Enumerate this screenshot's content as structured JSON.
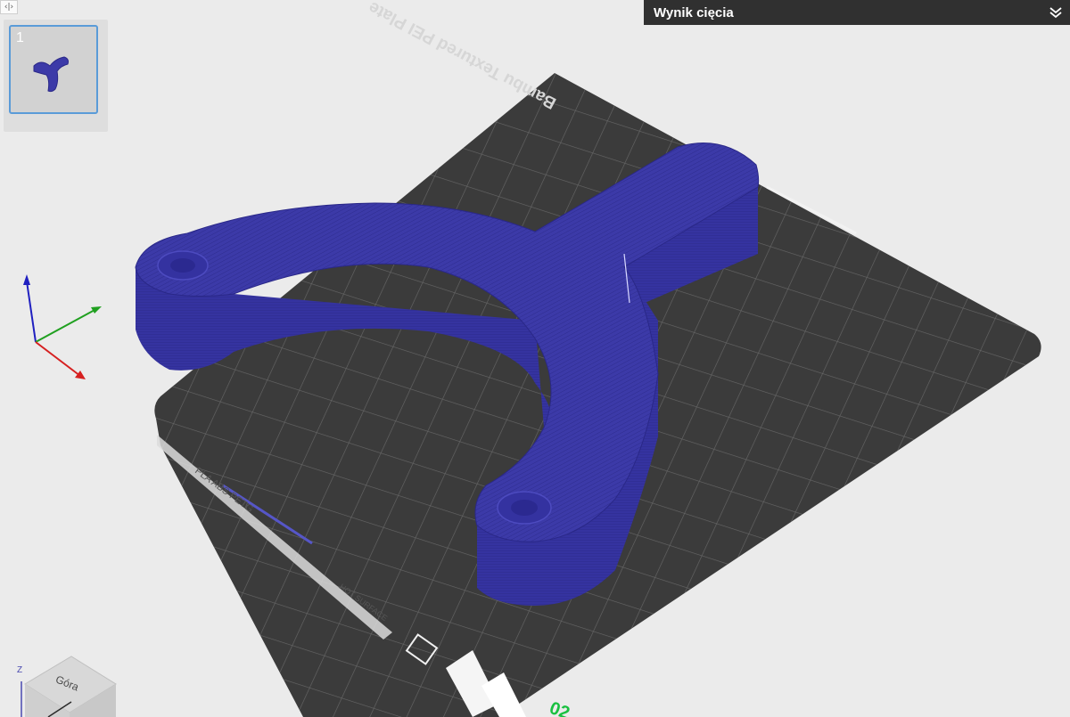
{
  "toolbar": {
    "collapse_glyph": "‹|›"
  },
  "plate_list": {
    "plates": [
      {
        "number": "1",
        "selected": true
      }
    ]
  },
  "slice_result": {
    "title": "Wynik cięcia",
    "icon": "double-chevron-down-icon"
  },
  "build_plate": {
    "name_text": "Bambu Textured PEI Plate",
    "label_text": "PLA ABS PETG",
    "hot_surface_text": "HOT SURFACE"
  },
  "view_cube": {
    "top_face_label": "Góra",
    "axis_label": "Z"
  },
  "colors": {
    "model": "#3c3aa8",
    "plate": "#3b3b3b",
    "grid": "#6a6a6a",
    "background": "#ebebeb",
    "header_bg": "#303030",
    "selection": "#5a9bd8",
    "axis_x": "#d62020",
    "axis_y": "#20a020",
    "axis_z": "#2020c0",
    "edge_text": "#19c040"
  }
}
